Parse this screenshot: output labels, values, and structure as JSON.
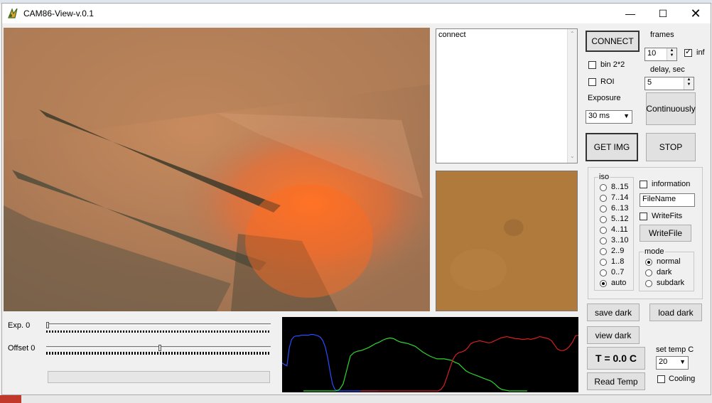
{
  "window": {
    "title": "CAM86-View-v.0.1"
  },
  "log": {
    "text": "connect"
  },
  "buttons": {
    "connect": "CONNECT",
    "continuously": "Continuously",
    "get_img": "GET IMG",
    "stop": "STOP",
    "write_file": "WriteFile",
    "save_dark": "save dark",
    "load_dark": "load dark",
    "view_dark": "view dark",
    "read_temp": "Read Temp"
  },
  "options": {
    "bin": "bin 2*2",
    "roi": "ROI"
  },
  "frames": {
    "label": "frames",
    "value": "10",
    "inf_label": "inf",
    "inf_checked": true
  },
  "delay": {
    "label": "delay, sec",
    "value": "5"
  },
  "exposure": {
    "label": "Exposure",
    "value": "30 ms"
  },
  "iso": {
    "label": "iso",
    "options": [
      "8..15",
      "7..14",
      "6..13",
      "5..12",
      "4..11",
      "3..10",
      "2..9",
      "1..8",
      "0..7",
      "auto"
    ],
    "selected": "auto"
  },
  "information": {
    "label": "information"
  },
  "filename": {
    "value": "FileName"
  },
  "writefits": {
    "label": "WriteFits"
  },
  "mode": {
    "label": "mode",
    "options": [
      "normal",
      "dark",
      "subdark"
    ],
    "selected": "normal"
  },
  "temperature": {
    "display": "T = 0.0 C",
    "set_label": "set temp C",
    "set_value": "20",
    "cooling_label": "Cooling"
  },
  "sliders": {
    "exposure": {
      "label": "Exp. 0",
      "value": 0
    },
    "offset": {
      "label": "Offset 0",
      "value": 0
    }
  },
  "histogram": {
    "series": [
      {
        "color": "#2a4dff",
        "values": [
          40,
          38,
          36,
          62,
          74,
          78,
          79,
          79,
          80,
          80,
          80,
          80,
          81,
          81,
          80,
          79,
          77,
          72,
          63,
          48,
          28,
          10,
          2,
          0,
          0,
          0,
          0,
          0,
          0,
          0,
          0,
          0,
          0,
          0,
          0,
          0,
          0,
          0,
          0,
          0,
          0
        ]
      },
      {
        "color": "#2fd62f",
        "values": [
          0,
          0,
          0,
          0,
          0,
          0,
          0,
          0,
          0,
          0,
          2,
          10,
          30,
          50,
          55,
          57,
          58,
          60,
          62,
          65,
          68,
          70,
          73,
          75,
          76,
          75,
          72,
          70,
          69,
          68,
          66,
          64,
          60,
          56,
          53,
          50,
          48,
          46,
          46,
          46,
          45,
          44,
          41,
          39,
          34,
          29,
          26,
          24,
          22,
          20,
          18,
          16,
          14,
          10,
          5,
          2,
          1,
          0,
          0,
          0,
          0,
          0,
          0
        ]
      },
      {
        "color": "#d42020",
        "values": [
          0,
          0,
          0,
          0,
          0,
          0,
          0,
          0,
          0,
          0,
          0,
          0,
          0,
          0,
          0,
          0,
          0,
          0,
          0,
          0,
          0,
          0,
          0,
          0,
          0,
          0,
          0,
          2,
          8,
          20,
          33,
          45,
          52,
          55,
          56,
          58,
          62,
          68,
          70,
          71,
          72,
          71,
          70,
          69,
          70,
          72,
          74,
          76,
          77,
          78,
          77,
          76,
          75,
          75,
          74,
          74,
          75,
          74,
          75,
          76,
          78,
          77,
          76,
          75,
          72,
          66,
          60,
          58,
          58,
          60,
          64,
          70,
          79,
          80
        ]
      }
    ]
  }
}
